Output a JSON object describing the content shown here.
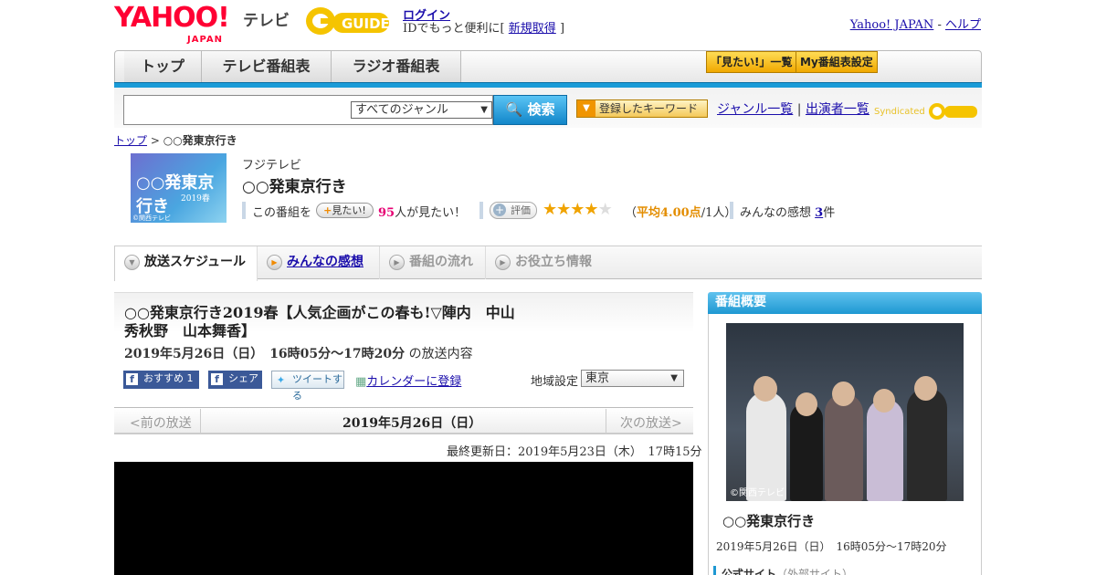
{
  "header": {
    "logo_yahoo": "YAHOO!",
    "logo_japan": "JAPAN",
    "logo_tv": "テレビ",
    "logo_gguide": "GUIDE",
    "login_label": "ログイン",
    "login_sub_prefix": "IDでもっと便利に[",
    "signup_label": "新規取得",
    "login_sub_suffix": "]",
    "yahoo_japan_link": "Yahoo! JAPAN",
    "help_link": "ヘルプ"
  },
  "nav": {
    "tabs": [
      "トップ",
      "テレビ番組表",
      "ラジオ番組表"
    ],
    "want_list_btn": "「見たい!」一覧",
    "my_schedule_btn": "My番組表設定"
  },
  "search": {
    "genre_selected": "すべてのジャンル",
    "button": "検索",
    "keyword_btn": "登録したキーワード",
    "genre_list": "ジャンル一覧",
    "performer_list": "出演者一覧",
    "syndicated": "Syndicated"
  },
  "breadcrumb": {
    "top": "トップ",
    "sep": ">",
    "current": "○○発東京行き"
  },
  "program": {
    "thumb_text": "○○発東京行き",
    "thumb_year": "2019春",
    "thumb_credit": "©関西テレビ",
    "station": "フジテレビ",
    "title": "○○発東京行き",
    "want_prefix": "この番組を",
    "want_btn": "見たい!",
    "want_count": "95",
    "want_suffix": "人が見たい！",
    "rate_btn": "評価",
    "rating": 4,
    "avg_prefix": "（",
    "avg_value": "平均4.00点",
    "avg_suffix": "/1人）",
    "impressions_label": "みんなの感想",
    "impressions_count": "3",
    "impressions_unit": "件"
  },
  "tabs": [
    "放送スケジュール",
    "みんなの感想",
    "番組の流れ",
    "お役立ち情報"
  ],
  "episode": {
    "title": "○○発東京行き2019春【人気企画がこの春も!▽陣内　中山秀秋野　山本舞香】",
    "date": "2019年5月26日（日）　16時05分～17時20分",
    "date_suffix": "の放送内容",
    "fb_recommend": "おすすめ 1",
    "fb_share": "シェア",
    "tweet": "ツイートする",
    "calendar": "カレンダーに登録",
    "region_label": "地域設定",
    "region_value": "東京",
    "prev": "<前の放送",
    "next": "次の放送>",
    "center_date": "2019年5月26日（日）",
    "updated": "最終更新日：2019年5月23日（木）　17時15分"
  },
  "sidebar": {
    "header": "番組概要",
    "photo_credit": "©関西テレビ",
    "title": "○○発東京行き",
    "date": "2019年5月26日（日）　16時05分～17時20分",
    "official_label": "公式サイト",
    "official_note": "（外部サイト）"
  },
  "colors": {
    "accent_blue": "#1a9bd7",
    "star": "#f0a300",
    "yahoo_red": "#ff0033"
  }
}
